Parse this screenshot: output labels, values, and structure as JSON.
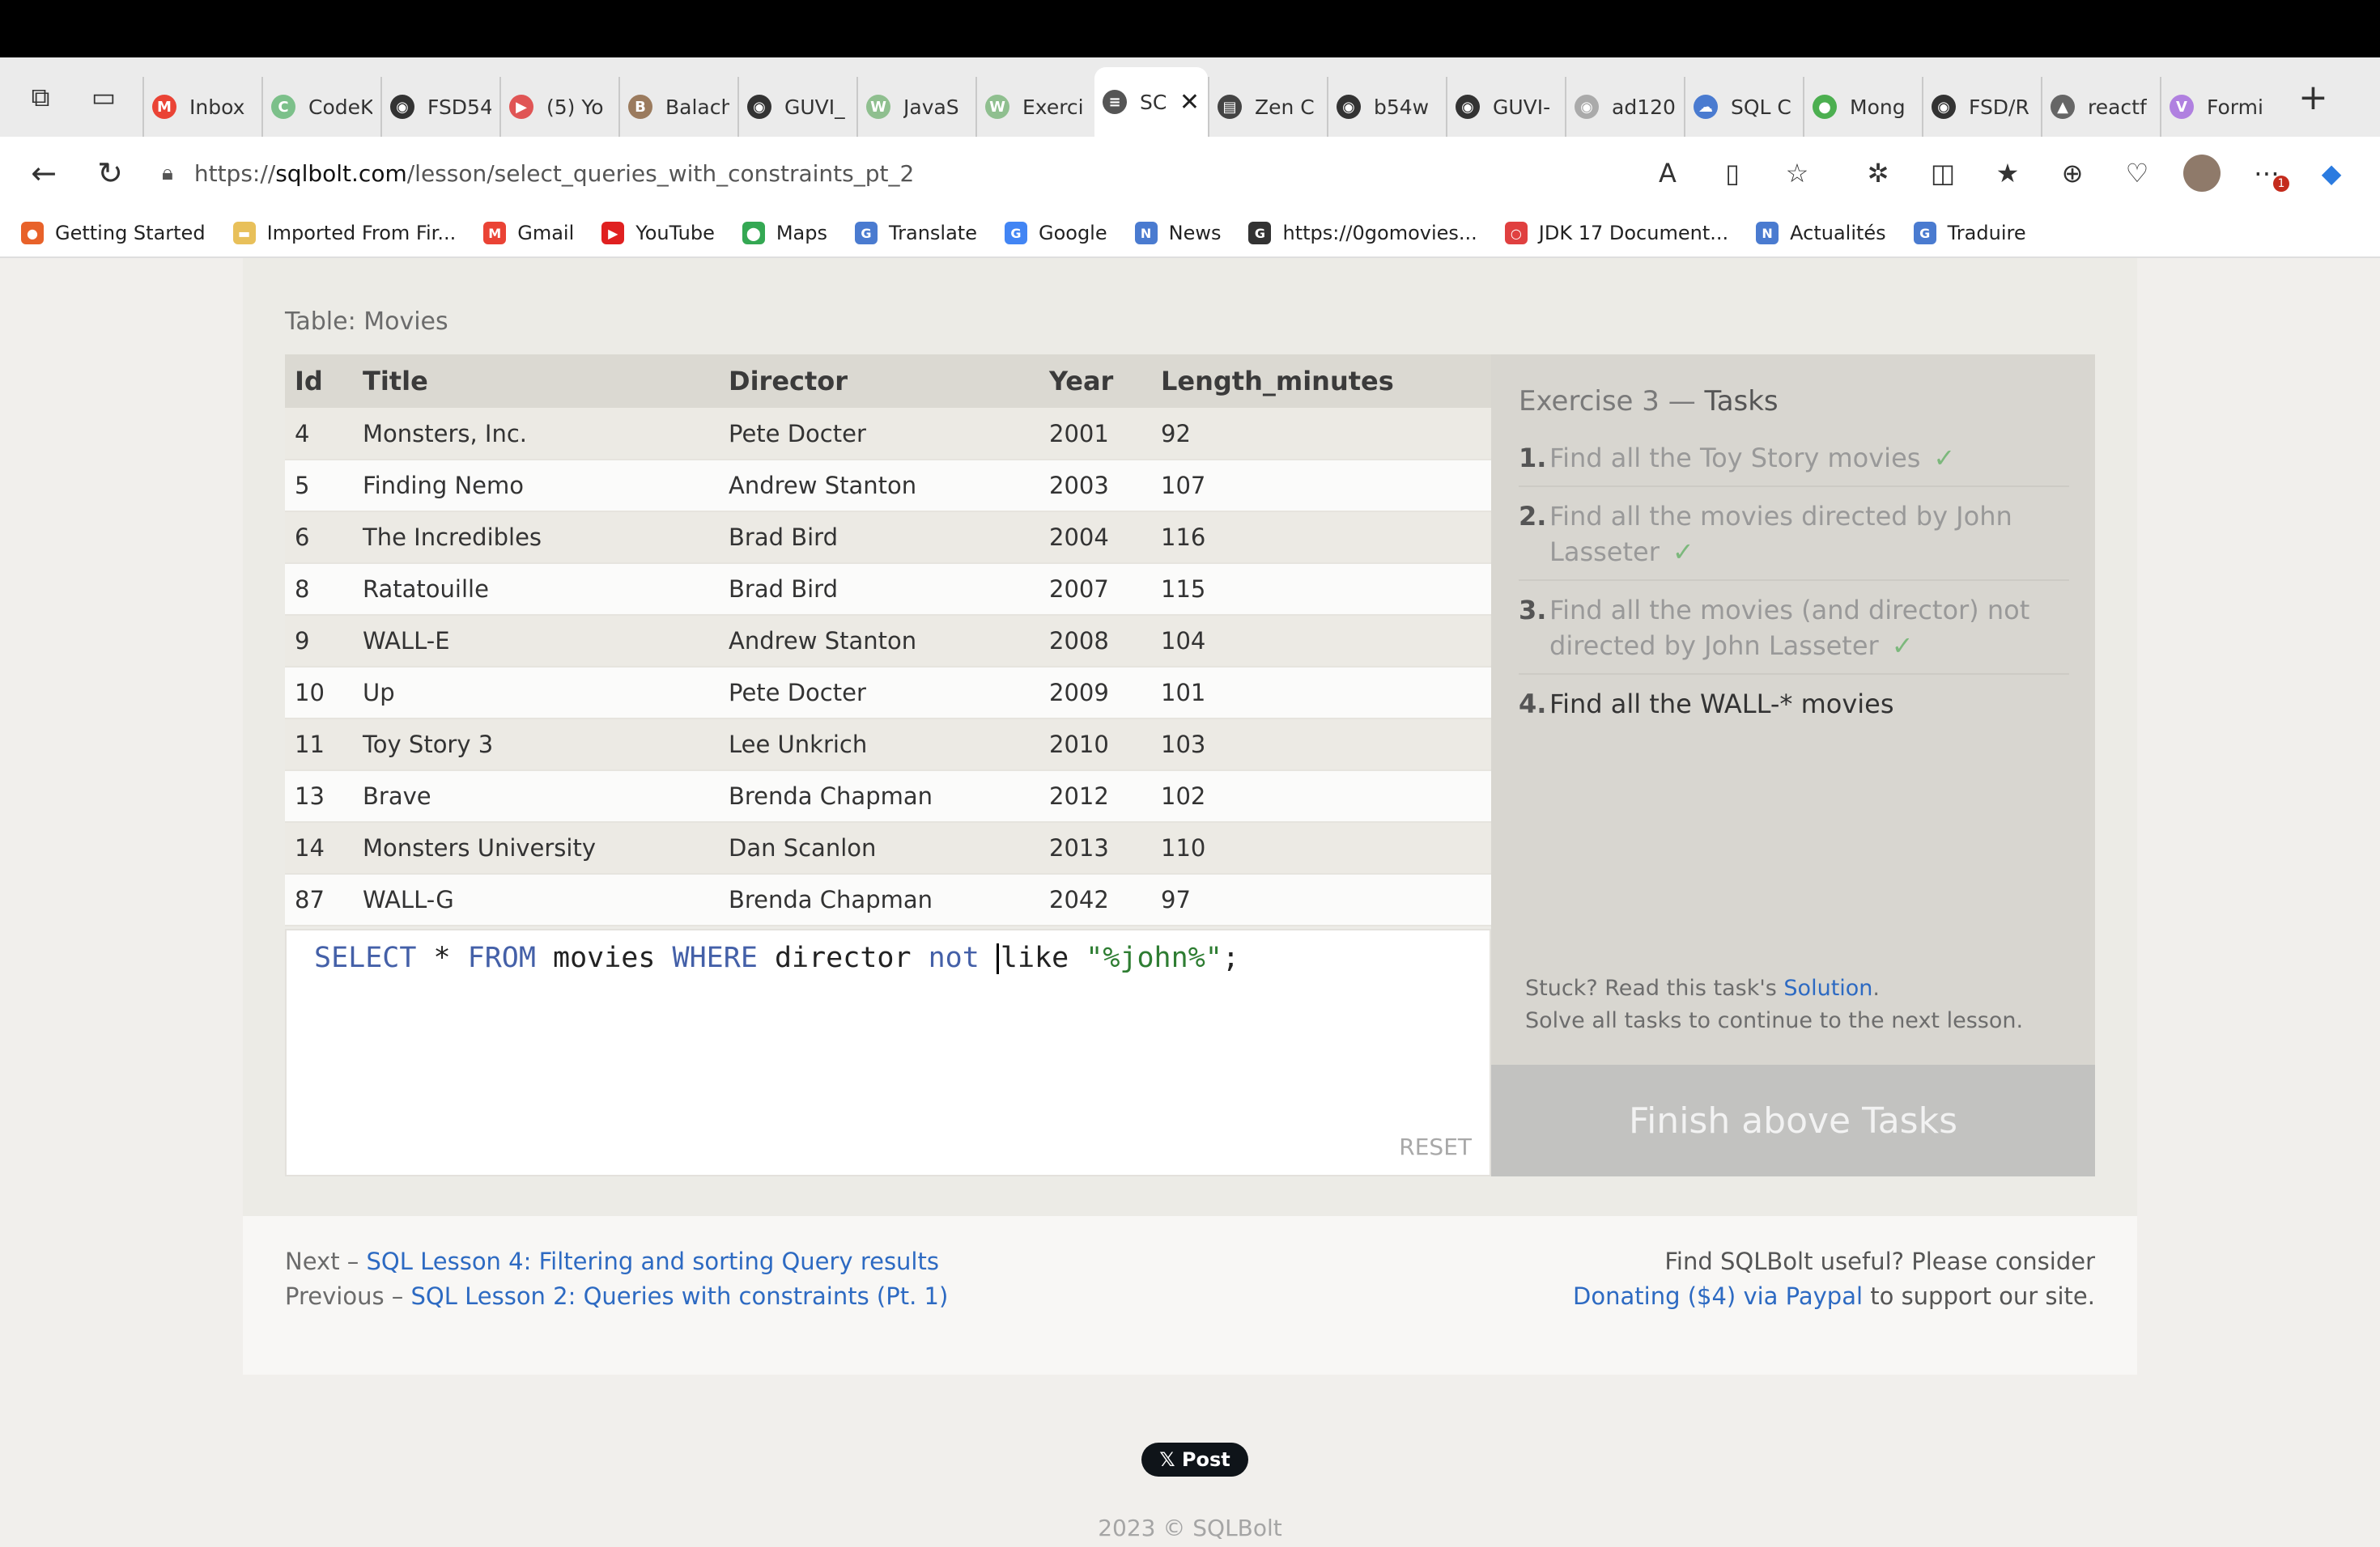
{
  "browser": {
    "tabs": [
      {
        "label": "Inbox",
        "icon": "gmail-icon",
        "color": "#ea4335",
        "glyph": "M"
      },
      {
        "label": "CodeK",
        "icon": "codekata-icon",
        "color": "#7cc08a",
        "glyph": "C"
      },
      {
        "label": "FSD54",
        "icon": "github-icon",
        "color": "#333333",
        "glyph": "◉"
      },
      {
        "label": "(5) Yo",
        "icon": "youtube-icon",
        "color": "#e05555",
        "glyph": "▶"
      },
      {
        "label": "Balach",
        "icon": "profile-icon",
        "color": "#9b7b5e",
        "glyph": "B"
      },
      {
        "label": "GUVI_",
        "icon": "github-icon",
        "color": "#333333",
        "glyph": "◉"
      },
      {
        "label": "JavaS",
        "icon": "w3schools-icon",
        "color": "#8fbf8f",
        "glyph": "W"
      },
      {
        "label": "Exerci",
        "icon": "w3schools-icon",
        "color": "#8fbf8f",
        "glyph": "W"
      },
      {
        "label": "SC",
        "icon": "database-icon",
        "color": "#555555",
        "glyph": "≡",
        "active": true
      },
      {
        "label": "Zen C",
        "icon": "zen-icon",
        "color": "#444444",
        "glyph": "▤"
      },
      {
        "label": "b54w",
        "icon": "github-icon",
        "color": "#333333",
        "glyph": "◉"
      },
      {
        "label": "GUVI-",
        "icon": "github-icon",
        "color": "#333333",
        "glyph": "◉"
      },
      {
        "label": "ad120",
        "icon": "github-icon",
        "color": "#aaaaaa",
        "glyph": "◉"
      },
      {
        "label": "SQL C",
        "icon": "sql-cloud-icon",
        "color": "#4a7bd0",
        "glyph": "☁"
      },
      {
        "label": "Mong",
        "icon": "mongodb-icon",
        "color": "#4caf50",
        "glyph": "●"
      },
      {
        "label": "FSD/R",
        "icon": "github-icon",
        "color": "#333333",
        "glyph": "◉"
      },
      {
        "label": "reactf",
        "icon": "react-icon",
        "color": "#666666",
        "glyph": "▲"
      },
      {
        "label": "Formi",
        "icon": "vercel-icon",
        "color": "#b080e0",
        "glyph": "V"
      }
    ],
    "url_prefix": "https://",
    "url_host": "sqlbolt.com",
    "url_path": "/lesson/select_queries_with_constraints_pt_2",
    "notification_count": "1",
    "bookmarks": [
      {
        "label": "Getting Started",
        "icon": "firefox-icon",
        "color": "#e8622a",
        "glyph": "●"
      },
      {
        "label": "Imported From Fir...",
        "icon": "folder-icon",
        "color": "#e8c05a",
        "glyph": "▬"
      },
      {
        "label": "Gmail",
        "icon": "gmail-icon",
        "color": "#ea4335",
        "glyph": "M"
      },
      {
        "label": "YouTube",
        "icon": "youtube-icon",
        "color": "#e02020",
        "glyph": "▶"
      },
      {
        "label": "Maps",
        "icon": "maps-icon",
        "color": "#34a853",
        "glyph": "⬤"
      },
      {
        "label": "Translate",
        "icon": "translate-icon",
        "color": "#4a7bd0",
        "glyph": "G"
      },
      {
        "label": "Google",
        "icon": "google-icon",
        "color": "#4285f4",
        "glyph": "G"
      },
      {
        "label": "News",
        "icon": "news-icon",
        "color": "#4a7bd0",
        "glyph": "N"
      },
      {
        "label": "https://0gomovies...",
        "icon": "movies-icon",
        "color": "#333333",
        "glyph": "G"
      },
      {
        "label": "JDK 17 Document...",
        "icon": "oracle-icon",
        "color": "#e04040",
        "glyph": "○"
      },
      {
        "label": "Actualités",
        "icon": "news-icon",
        "color": "#4a7bd0",
        "glyph": "N"
      },
      {
        "label": "Traduire",
        "icon": "translate-icon",
        "color": "#4a7bd0",
        "glyph": "G"
      }
    ]
  },
  "lesson": {
    "table_caption": "Table: Movies",
    "columns": [
      "Id",
      "Title",
      "Director",
      "Year",
      "Length_minutes"
    ],
    "rows": [
      [
        "4",
        "Monsters, Inc.",
        "Pete Docter",
        "2001",
        "92"
      ],
      [
        "5",
        "Finding Nemo",
        "Andrew Stanton",
        "2003",
        "107"
      ],
      [
        "6",
        "The Incredibles",
        "Brad Bird",
        "2004",
        "116"
      ],
      [
        "8",
        "Ratatouille",
        "Brad Bird",
        "2007",
        "115"
      ],
      [
        "9",
        "WALL-E",
        "Andrew Stanton",
        "2008",
        "104"
      ],
      [
        "10",
        "Up",
        "Pete Docter",
        "2009",
        "101"
      ],
      [
        "11",
        "Toy Story 3",
        "Lee Unkrich",
        "2010",
        "103"
      ],
      [
        "13",
        "Brave",
        "Brenda Chapman",
        "2012",
        "102"
      ],
      [
        "14",
        "Monsters University",
        "Dan Scanlon",
        "2013",
        "110"
      ],
      [
        "87",
        "WALL-G",
        "Brenda Chapman",
        "2042",
        "97"
      ]
    ],
    "query": {
      "kw_select": "SELECT",
      "star": " * ",
      "kw_from": "FROM",
      "table": " movies ",
      "kw_where": "WHERE",
      "column": " director ",
      "kw_not": "not",
      "like": "like ",
      "pattern": "\"%john%\"",
      "end": ";"
    },
    "reset_label": "RESET",
    "tasks_title_prefix": "Exercise 3 — ",
    "tasks_title": "Tasks",
    "tasks": [
      {
        "num": "1.",
        "text": "Find all the Toy Story movies",
        "done": true
      },
      {
        "num": "2.",
        "text": "Find all the movies directed by John Lasseter",
        "done": true
      },
      {
        "num": "3.",
        "text": "Find all the movies (and director) not directed by John Lasseter",
        "done": true
      },
      {
        "num": "4.",
        "text": "Find all the WALL-* movies",
        "done": false
      }
    ],
    "check_mark": "✓",
    "hint_prefix": "Stuck? Read this task's ",
    "hint_link": "Solution",
    "hint_suffix": ".",
    "hint_line2": "Solve all tasks to continue to the next lesson.",
    "finish_label": "Finish above Tasks"
  },
  "footer": {
    "next_prefix": "Next – ",
    "next_link": "SQL Lesson 4: Filtering and sorting Query results",
    "prev_prefix": "Previous – ",
    "prev_link": "SQL Lesson 2: Queries with constraints (Pt. 1)",
    "donate_line1": "Find SQLBolt useful? Please consider",
    "donate_link": "Donating ($4) via Paypal",
    "donate_suffix": " to support our site.",
    "post_label": "𝕏 Post",
    "copyright": "2023 © SQLBolt"
  }
}
